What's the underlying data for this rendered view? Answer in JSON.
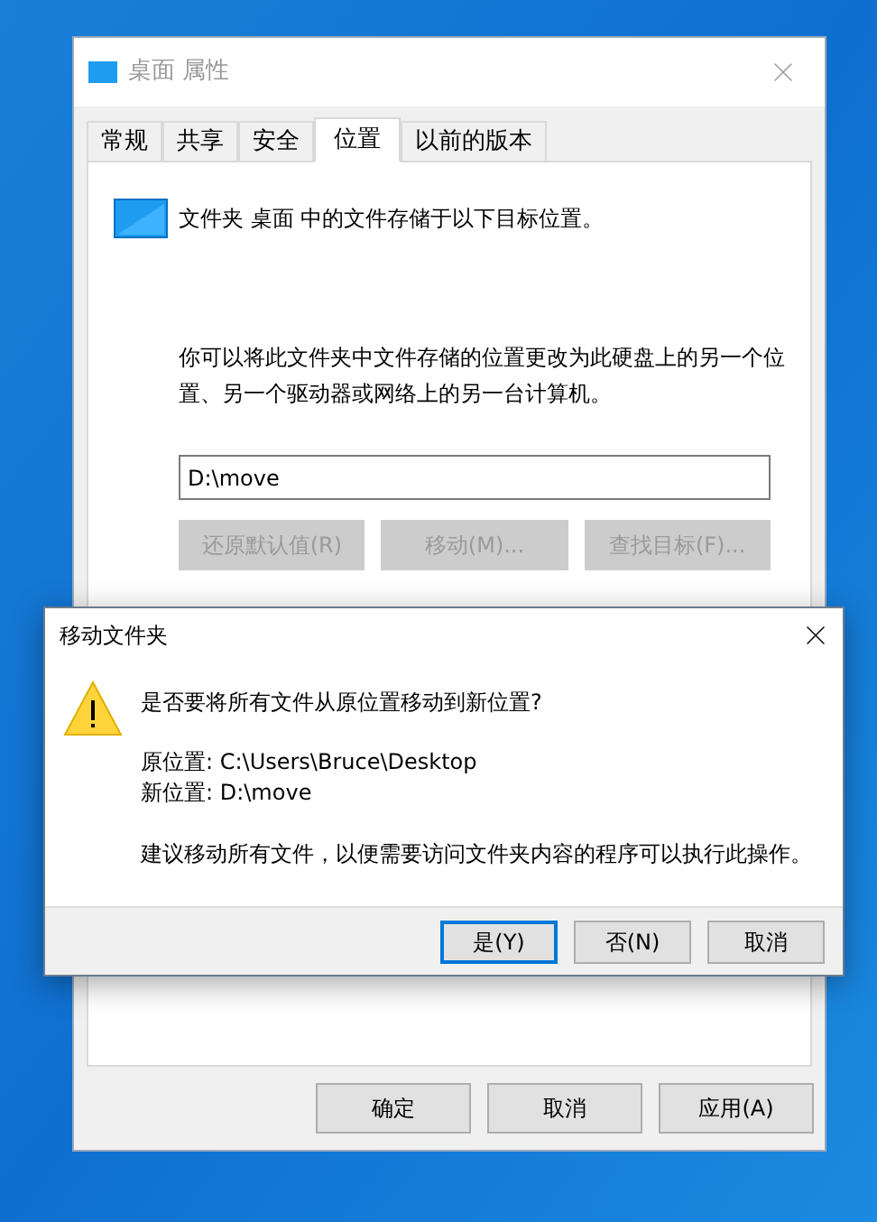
{
  "properties_window": {
    "title": "桌面 属性",
    "active": false,
    "tabs": [
      {
        "label": "常规",
        "selected": false
      },
      {
        "label": "共享",
        "selected": false
      },
      {
        "label": "安全",
        "selected": false
      },
      {
        "label": "位置",
        "selected": true
      },
      {
        "label": "以前的版本",
        "selected": false
      }
    ],
    "location_tab": {
      "heading": "文件夹 桌面 中的文件存储于以下目标位置。",
      "description": "你可以将此文件夹中文件存储的位置更改为此硬盘上的另一个位置、另一个驱动器或网络上的另一台计算机。",
      "path": {
        "value": "D:\\move"
      },
      "buttons": [
        {
          "label": "还原默认值(R)",
          "disabled": true
        },
        {
          "label": "移动(M)...",
          "disabled": true
        },
        {
          "label": "查找目标(F)...",
          "disabled": true
        }
      ]
    },
    "buttons": [
      {
        "label": "确定"
      },
      {
        "label": "取消"
      },
      {
        "label": "应用(A)"
      }
    ]
  },
  "move_dialog": {
    "title": "移动文件夹",
    "question": "是否要将所有文件从原位置移动到新位置?",
    "details": [
      "原位置: C:\\Users\\Bruce\\Desktop",
      "新位置: D:\\move"
    ],
    "advice": "建议移动所有文件，以便需要访问文件夹内容的程序可以执行此操作。",
    "buttons": [
      {
        "label": "是(Y)",
        "selected": true
      },
      {
        "label": "否(N)",
        "selected": false
      },
      {
        "label": "取消",
        "selected": false
      }
    ]
  }
}
